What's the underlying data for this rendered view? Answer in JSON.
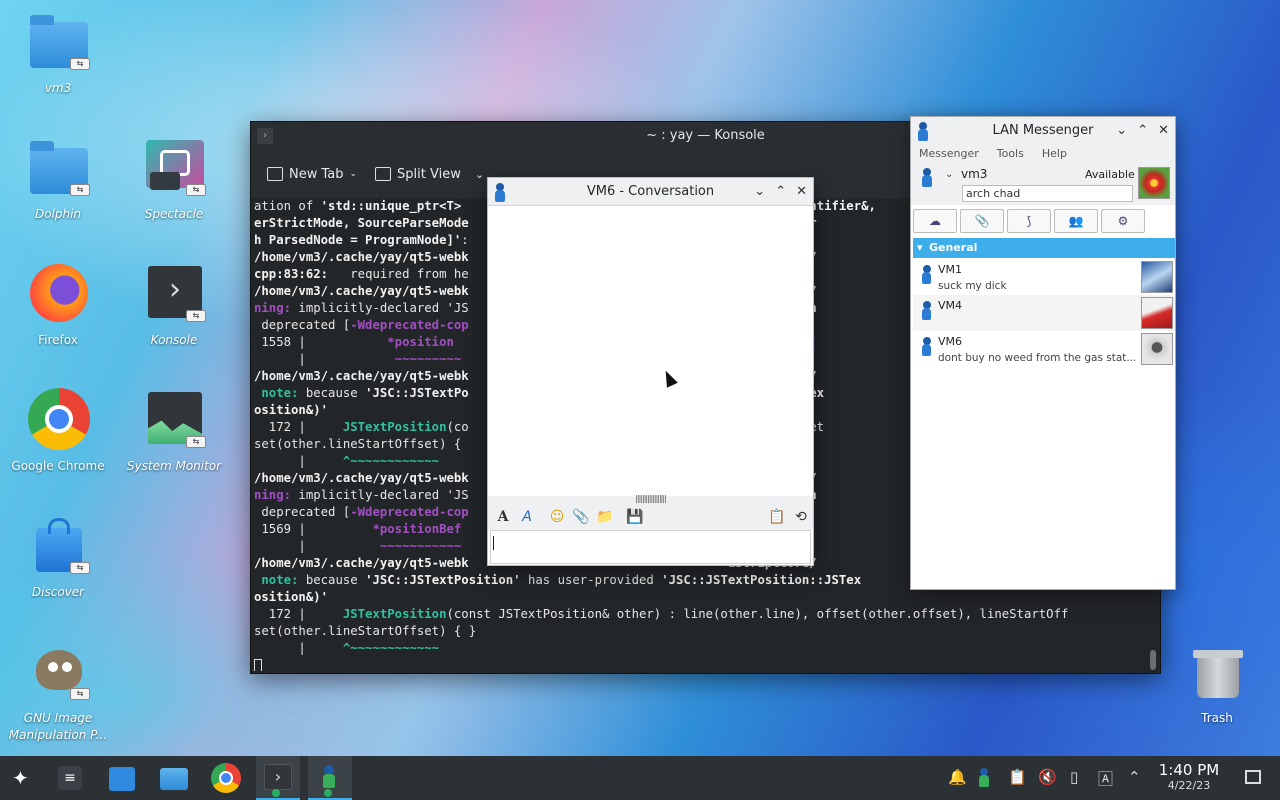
{
  "desktop": {
    "icons": [
      {
        "label": "vm3"
      },
      {
        "label": "Dolphin"
      },
      {
        "label": "Spectacle"
      },
      {
        "label": "Firefox"
      },
      {
        "label": "Konsole"
      },
      {
        "label": "Google Chrome"
      },
      {
        "label": "System Monitor"
      },
      {
        "label": "Discover"
      },
      {
        "label": "GNU Image Manipulation P..."
      },
      {
        "label": "Trash"
      }
    ]
  },
  "konsole": {
    "title": "~ : yay — Konsole",
    "toolbar": {
      "new_tab": "New Tab",
      "split_view": "Split View"
    },
    "lines": [
      [
        {
          "c": "",
          "t": "ation of "
        },
        {
          "c": "b",
          "t": "'std::unique_ptr<T> "
        },
        {
          "c": "",
          "t": "                                           "
        },
        {
          "c": "b",
          "t": "Identifier&,"
        }
      ],
      [
        {
          "c": "b",
          "t": "erStrictMode, SourceParseMode"
        },
        {
          "c": "",
          "t": "                                   "
        },
        {
          "c": "b",
          "t": "ion*, Constr"
        }
      ],
      [
        {
          "c": "b",
          "t": "h ParsedNode = ProgramNode]'"
        },
        {
          "c": "",
          "t": ":"
        }
      ],
      [
        {
          "c": "b",
          "t": "/home/vm3/.cache/yay/qt5-webk"
        },
        {
          "c": "",
          "t": "                                   "
        },
        {
          "c": "b",
          "t": "aScriptCore/"
        }
      ],
      [
        {
          "c": "b",
          "t": "cpp:83:62:"
        },
        {
          "c": "",
          "t": "   required from he"
        }
      ],
      [
        {
          "c": "b",
          "t": "/home/vm3/.cache/yay/qt5-webk"
        },
        {
          "c": "",
          "t": "                                   "
        },
        {
          "c": "b",
          "t": "aScriptCore/"
        }
      ],
      [
        {
          "c": "m",
          "t": "ning:"
        },
        {
          "c": "",
          "t": " implicitly-declared 'JS"
        },
        {
          "c": "",
          "t": "                                   "
        },
        {
          "c": "b",
          "t": "perator=(con"
        }
      ],
      [
        {
          "c": "",
          "t": " deprecated ["
        },
        {
          "c": "m",
          "t": "-Wdeprecated-cop"
        }
      ],
      [
        {
          "c": "",
          "t": " 1558 |           "
        },
        {
          "c": "m",
          "t": "*position"
        },
        {
          "c": "",
          "t": "                                     "
        },
        {
          "c": "m",
          "t": "LastNewline("
        }
      ],
      [
        {
          "c": "",
          "t": "      |            "
        },
        {
          "c": "m",
          "t": "~~~~~~~~~"
        }
      ],
      [
        {
          "c": "b",
          "t": "/home/vm3/.cache/yay/qt5-webk"
        },
        {
          "c": "",
          "t": "                                   "
        },
        {
          "c": "b",
          "t": "aScriptCore/"
        }
      ],
      [
        {
          "c": "g",
          "t": " note:"
        },
        {
          "c": "",
          "t": " because "
        },
        {
          "c": "b",
          "t": "'JSC::JSTextPo"
        },
        {
          "c": "",
          "t": "                                   "
        },
        {
          "c": "b",
          "t": "sition::JSTex"
        }
      ],
      [
        {
          "c": "b",
          "t": "osition&)'"
        }
      ],
      [
        {
          "c": "",
          "t": "  172 |     "
        },
        {
          "c": "g",
          "t": "JSTextPosition"
        },
        {
          "c": "",
          "t": "(co"
        },
        {
          "c": "",
          "t": "                                   line), offset"
        }
      ],
      [
        {
          "c": "",
          "t": "set(other.lineStartOffset) {"
        }
      ],
      [
        {
          "c": "",
          "t": "      |     "
        },
        {
          "c": "g",
          "t": "^~~~~~~~~~~~~"
        }
      ],
      [
        {
          "c": "b",
          "t": "/home/vm3/.cache/yay/qt5-webk"
        },
        {
          "c": "",
          "t": "                                   "
        },
        {
          "c": "b",
          "t": "aScriptCore/"
        }
      ],
      [
        {
          "c": "m",
          "t": "ning:"
        },
        {
          "c": "",
          "t": " implicitly-declared 'JS"
        },
        {
          "c": "",
          "t": "                                   "
        },
        {
          "c": "b",
          "t": "perator=(con"
        }
      ],
      [
        {
          "c": "",
          "t": " deprecated ["
        },
        {
          "c": "m",
          "t": "-Wdeprecated-cop"
        }
      ],
      [
        {
          "c": "",
          "t": " 1569 |         "
        },
        {
          "c": "m",
          "t": "*positionBef"
        },
        {
          "c": "",
          "t": "                                  "
        },
        {
          "c": "m",
          "t": "Newline"
        },
        {
          "c": "",
          "t": "();"
        }
      ],
      [
        {
          "c": "",
          "t": "      |          "
        },
        {
          "c": "m",
          "t": "~~~~~~~~~~~"
        }
      ],
      [
        {
          "c": "b",
          "t": "/home/vm3/.cache/yay/qt5-webk"
        },
        {
          "c": "",
          "t": "                                   "
        },
        {
          "c": "b",
          "t": "aScriptCore/"
        }
      ],
      [
        {
          "c": "g",
          "t": " note:"
        },
        {
          "c": "",
          "t": " because "
        },
        {
          "c": "b",
          "t": "'JSC::JSTextPosition'"
        },
        {
          "c": "",
          "t": " has user-provided "
        },
        {
          "c": "b",
          "t": "'JSC::JSTextPosition::JSTex"
        }
      ],
      [
        {
          "c": "b",
          "t": "osition&)'"
        }
      ],
      [
        {
          "c": "",
          "t": "  172 |     "
        },
        {
          "c": "g",
          "t": "JSTextPosition"
        },
        {
          "c": "",
          "t": "(const JSTextPosition& other) : line(other.line), offset(other.offset), lineStartOff"
        }
      ],
      [
        {
          "c": "",
          "t": "set(other.lineStartOffset) { }"
        }
      ],
      [
        {
          "c": "",
          "t": "      |     "
        },
        {
          "c": "g",
          "t": "^~~~~~~~~~~~~"
        }
      ]
    ]
  },
  "conversation": {
    "title": "VM6 - Conversation",
    "splitter": "||||||||||||||||||",
    "tools": [
      "A",
      "A",
      "☺",
      "📎",
      "📁",
      "💾",
      "📋",
      "⟲"
    ],
    "input_value": ""
  },
  "lan": {
    "title": "LAN Messenger",
    "menu": [
      "Messenger",
      "Tools",
      "Help"
    ],
    "user": {
      "name": "vm3",
      "status": "Available",
      "note": "arch chad"
    },
    "toolbar": [
      "☁",
      "📎",
      "⟆",
      "👥",
      "⚙"
    ],
    "group": "General",
    "contacts": [
      {
        "name": "VM1",
        "message": "suck my dick"
      },
      {
        "name": "VM4",
        "message": ""
      },
      {
        "name": "VM6",
        "message": "dont buy no weed from the gas stat..."
      }
    ]
  },
  "taskbar": {
    "clock": {
      "time": "1:40 PM",
      "date": "4/22/23"
    }
  },
  "colors": {
    "accent": "#3daee9",
    "terminal_bg": "#232629",
    "taskbar_bg": "#2c3136"
  }
}
